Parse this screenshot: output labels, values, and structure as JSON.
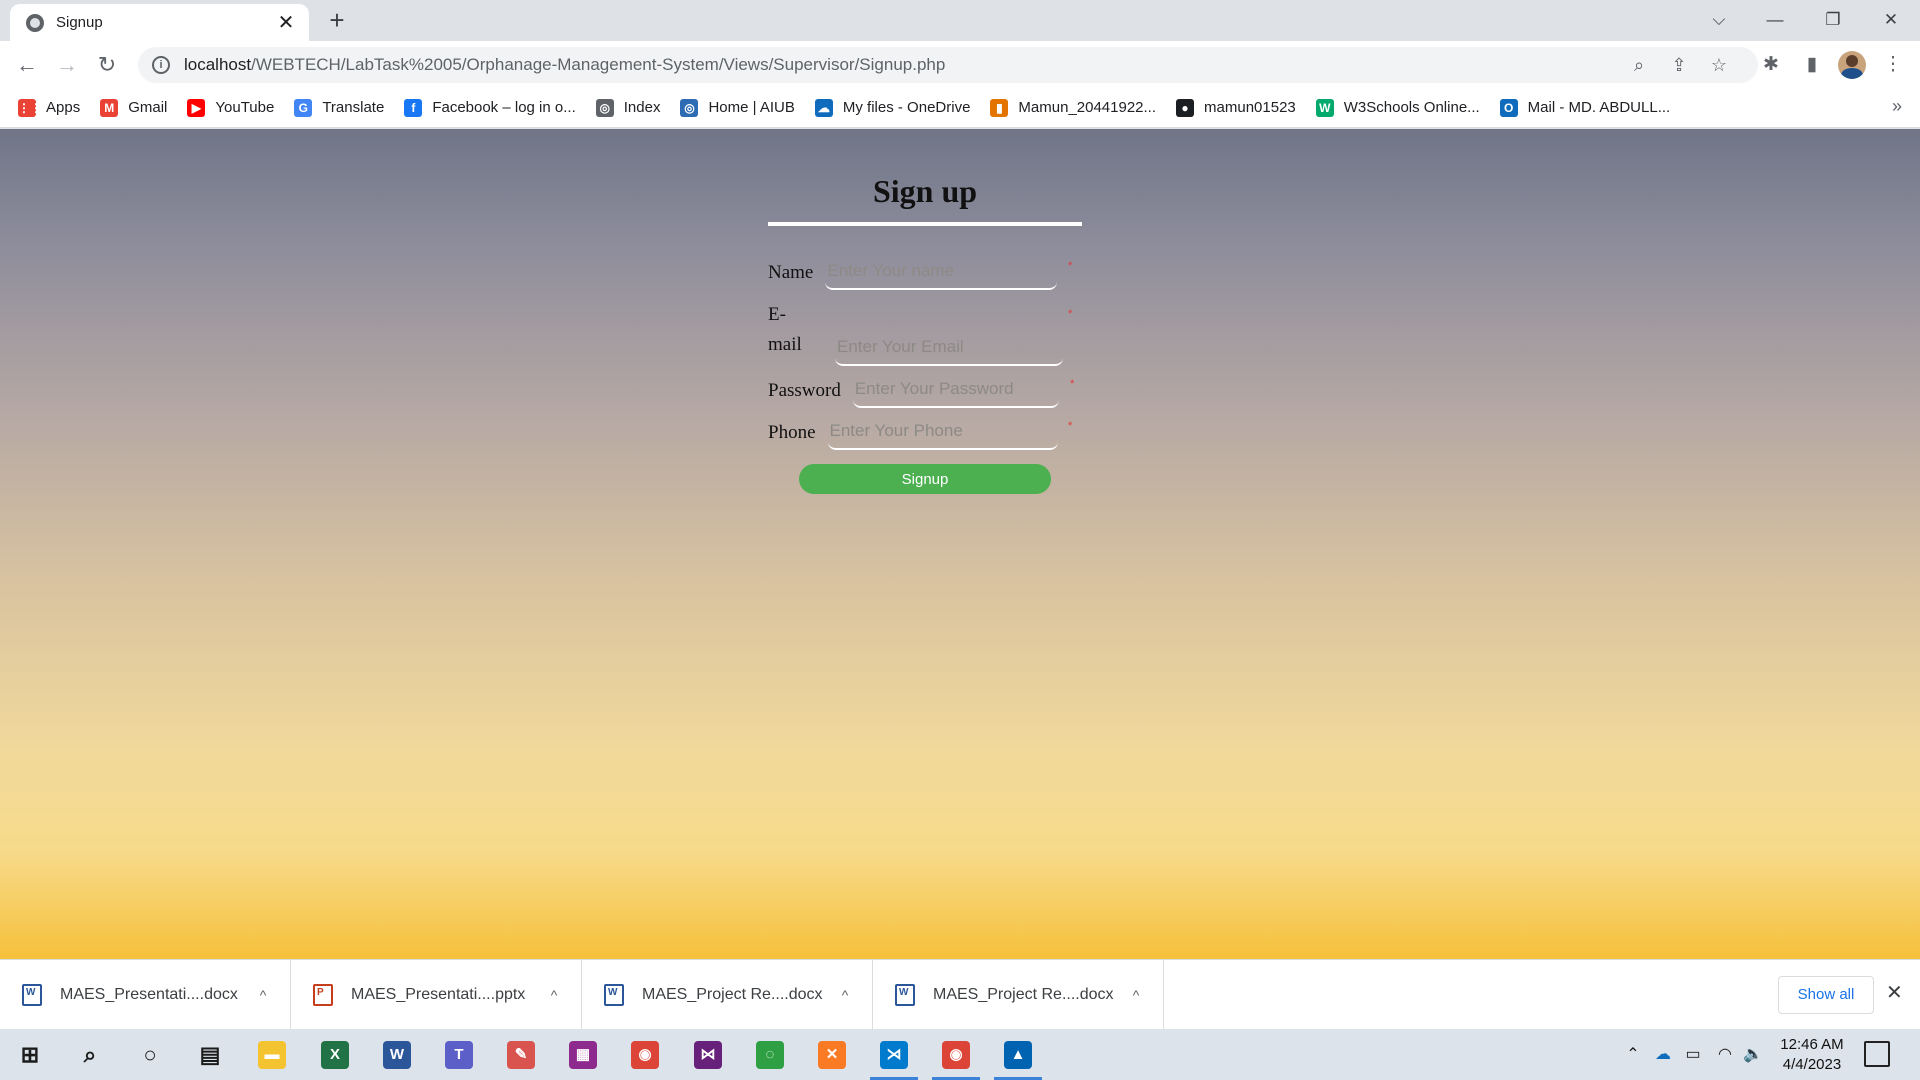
{
  "browser": {
    "tab": {
      "title": "Signup",
      "close": "✕"
    },
    "new_tab": "+",
    "window_controls": {
      "tab_search": "⌵",
      "minimize": "—",
      "restore": "❐",
      "close": "✕"
    },
    "nav": {
      "back": "←",
      "forward": "→",
      "reload": "↻"
    },
    "url_host": "localhost",
    "url_path": "/WEBTECH/LabTask%2005/Orphanage-Management-System/Views/Supervisor/Signup.php",
    "omnibox_icons": {
      "zoom": "⌕",
      "share": "⇪",
      "bookmark": "☆"
    },
    "toolbar_icons": {
      "extensions": "✱",
      "side_panel": "▮",
      "menu": "⋮"
    },
    "bookmarks": [
      {
        "label": "Apps",
        "icon": "apps-grid-icon",
        "color": "#ea4335",
        "glyph": "⋮⋮"
      },
      {
        "label": "Gmail",
        "icon": "gmail-icon",
        "color": "#ea4335",
        "glyph": "M"
      },
      {
        "label": "YouTube",
        "icon": "youtube-icon",
        "color": "#ff0000",
        "glyph": "▶"
      },
      {
        "label": "Translate",
        "icon": "translate-icon",
        "color": "#4285f4",
        "glyph": "G"
      },
      {
        "label": "Facebook – log in o...",
        "icon": "facebook-icon",
        "color": "#1877f2",
        "glyph": "f"
      },
      {
        "label": "Index",
        "icon": "globe-icon",
        "color": "#5f6368",
        "glyph": "◎"
      },
      {
        "label": "Home | AIUB",
        "icon": "aiub-icon",
        "color": "#2d6cb5",
        "glyph": "◎"
      },
      {
        "label": "My files - OneDrive",
        "icon": "onedrive-icon",
        "color": "#0f6cbd",
        "glyph": "☁"
      },
      {
        "label": "Mamun_20441922...",
        "icon": "bar-chart-icon",
        "color": "#e37400",
        "glyph": "▮"
      },
      {
        "label": "mamun01523",
        "icon": "github-icon",
        "color": "#1b1f23",
        "glyph": "●"
      },
      {
        "label": "W3Schools Online...",
        "icon": "w3schools-icon",
        "color": "#04aa6d",
        "glyph": "W"
      },
      {
        "label": "Mail - MD. ABDULL...",
        "icon": "outlook-icon",
        "color": "#0f6cbd",
        "glyph": "O"
      }
    ],
    "bookmarks_more": "»"
  },
  "form": {
    "title": "Sign up",
    "fields": {
      "name": {
        "label": "Name",
        "placeholder": "Enter Your name"
      },
      "email": {
        "label": "E-mail",
        "placeholder": "Enter Your Email"
      },
      "password": {
        "label": "Password",
        "placeholder": "Enter Your Password"
      },
      "phone": {
        "label": "Phone",
        "placeholder": "Enter Your Phone"
      }
    },
    "required_mark": "*",
    "submit_label": "Signup"
  },
  "downloads": {
    "items": [
      {
        "name": "MAES_Presentati....docx",
        "type": "word",
        "color": "#2b579a",
        "glyph": "W"
      },
      {
        "name": "MAES_Presentati....pptx",
        "type": "powerpoint",
        "color": "#c43e1c",
        "glyph": "P"
      },
      {
        "name": "MAES_Project Re....docx",
        "type": "word",
        "color": "#2b579a",
        "glyph": "W"
      },
      {
        "name": "MAES_Project Re....docx",
        "type": "word",
        "color": "#2b579a",
        "glyph": "W"
      }
    ],
    "chevron": "^",
    "show_all": "Show all",
    "close": "✕"
  },
  "taskbar": {
    "apps": [
      {
        "name": "start-icon",
        "glyph": "⊞",
        "color": "#1b1b1b"
      },
      {
        "name": "search-icon",
        "glyph": "⌕",
        "color": "#1b1b1b"
      },
      {
        "name": "cortana-icon",
        "glyph": "○",
        "color": "#1b1b1b"
      },
      {
        "name": "task-view-icon",
        "glyph": "▤",
        "color": "#1b1b1b"
      },
      {
        "name": "file-explorer-icon",
        "glyph": "▬",
        "color": "#f4c430"
      },
      {
        "name": "excel-icon",
        "glyph": "X",
        "color": "#217346"
      },
      {
        "name": "word-icon",
        "glyph": "W",
        "color": "#2b579a"
      },
      {
        "name": "teams-icon",
        "glyph": "T",
        "color": "#5b5fc7"
      },
      {
        "name": "paint-icon",
        "glyph": "✎",
        "color": "#d9534f"
      },
      {
        "name": "winrar-icon",
        "glyph": "▦",
        "color": "#8e2a8e"
      },
      {
        "name": "chrome-icon",
        "glyph": "◉",
        "color": "#db4437"
      },
      {
        "name": "visual-studio-icon",
        "glyph": "⋈",
        "color": "#68217a"
      },
      {
        "name": "loader-icon",
        "glyph": "◌",
        "color": "#2ea043"
      },
      {
        "name": "xampp-icon",
        "glyph": "✕",
        "color": "#fb7a24"
      },
      {
        "name": "vscode-icon",
        "glyph": "⋊",
        "color": "#007acc"
      },
      {
        "name": "chrome-active-icon",
        "glyph": "◉",
        "color": "#db4437"
      },
      {
        "name": "photos-icon",
        "glyph": "▲",
        "color": "#0063b1"
      }
    ],
    "tray": {
      "chevron": "⌃",
      "onedrive": "☁",
      "battery": "▭",
      "wifi": "◠",
      "volume": "🔈"
    },
    "time": "12:46 AM",
    "date": "4/4/2023"
  }
}
